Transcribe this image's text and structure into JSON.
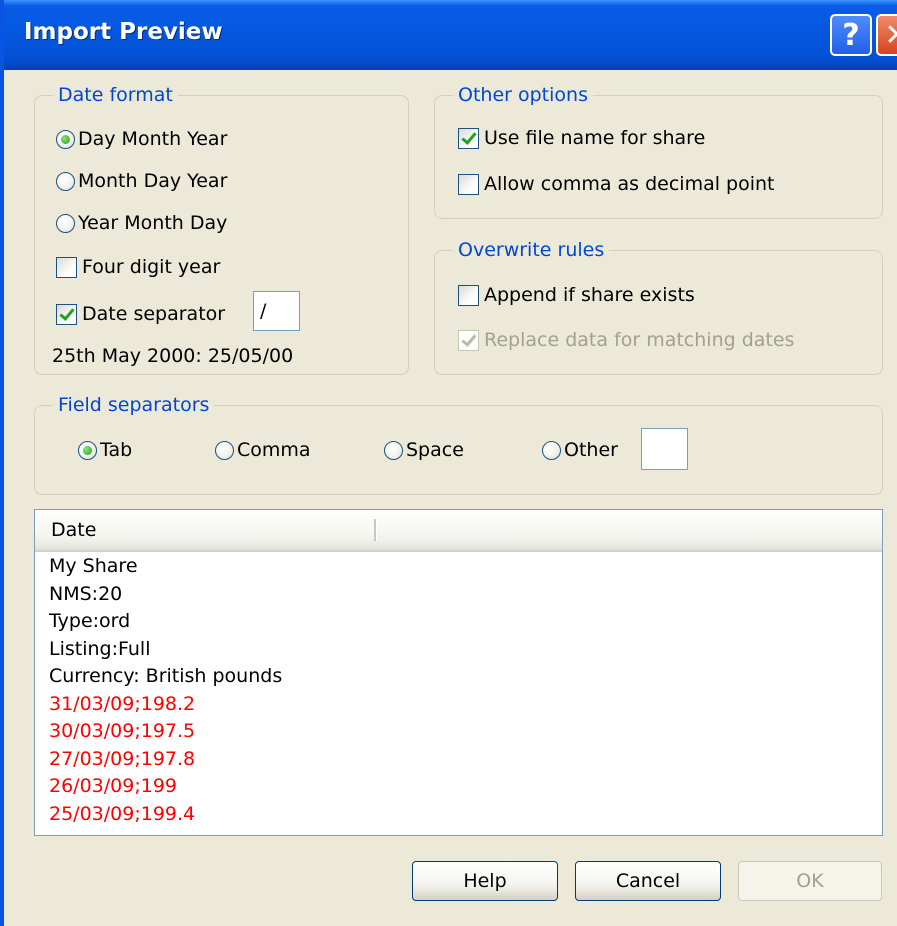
{
  "window": {
    "title": "Import Preview",
    "help_glyph": "?",
    "close_glyph": "✕"
  },
  "date_format": {
    "legend": "Date format",
    "options": [
      {
        "label": "Day Month Year",
        "selected": true
      },
      {
        "label": "Month Day Year",
        "selected": false
      },
      {
        "label": "Year Month Day",
        "selected": false
      }
    ],
    "four_digit_year": {
      "label": "Four digit year",
      "checked": false
    },
    "date_separator": {
      "label": "Date separator",
      "checked": true,
      "value": "/"
    },
    "example": "25th May 2000: 25/05/00"
  },
  "other_options": {
    "legend": "Other options",
    "use_file_name": {
      "label": "Use file name for share",
      "checked": true
    },
    "allow_comma": {
      "label": "Allow comma as decimal point",
      "checked": false
    }
  },
  "overwrite_rules": {
    "legend": "Overwrite rules",
    "append": {
      "label": "Append if share exists",
      "checked": false
    },
    "replace": {
      "label": "Replace data for matching dates",
      "checked": true,
      "disabled": true
    }
  },
  "field_separators": {
    "legend": "Field separators",
    "options": [
      {
        "label": "Tab",
        "selected": true
      },
      {
        "label": "Comma",
        "selected": false
      },
      {
        "label": "Space",
        "selected": false
      },
      {
        "label": "Other",
        "selected": false
      }
    ],
    "other_value": ""
  },
  "preview": {
    "column_header": "Date",
    "lines": [
      {
        "text": "My Share",
        "error": false
      },
      {
        "text": "NMS:20",
        "error": false
      },
      {
        "text": "Type:ord",
        "error": false
      },
      {
        "text": "Listing:Full",
        "error": false
      },
      {
        "text": "Currency: British pounds",
        "error": false
      },
      {
        "text": "31/03/09;198.2",
        "error": true
      },
      {
        "text": "30/03/09;197.5",
        "error": true
      },
      {
        "text": "27/03/09;197.8",
        "error": true
      },
      {
        "text": "26/03/09;199",
        "error": true
      },
      {
        "text": "25/03/09;199.4",
        "error": true
      }
    ],
    "error_color": "#ff0000"
  },
  "buttons": {
    "help": "Help",
    "cancel": "Cancel",
    "ok": "OK"
  }
}
